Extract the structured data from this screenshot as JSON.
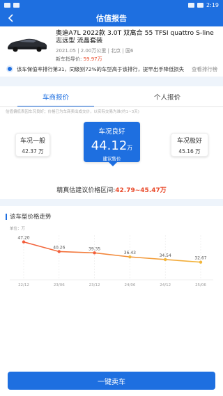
{
  "status_bar": {
    "time": "2:19"
  },
  "nav": {
    "title": "估值报告"
  },
  "car": {
    "name": "奥迪A7L 2022款 3.0T 双离合 55 TFSI quattro S-line 志远型 流晶套装",
    "meta": "2021.05 | 2.00万公里 | 北京 | 国6",
    "price_label": "新车指导价:",
    "price_value": "59.97万"
  },
  "rank": {
    "text": "该车保值率排行第31，同级别72%的车型高于该排行，提早出手降低损失",
    "link": "查看排行榜"
  },
  "tabs": [
    "车商报价",
    "个人报价"
  ],
  "note": "估值偏低表因车况良好；价格已为车商卖出成交价，以实际交易为准(约1~3天)",
  "conditions": {
    "left": {
      "label": "车况一般",
      "price": "42.37 万"
    },
    "mid": {
      "label": "车况良好",
      "price": "44.12",
      "unit": "万",
      "sub": "建议售价"
    },
    "right": {
      "label": "车况极好",
      "price": "45.16 万"
    }
  },
  "range": {
    "label": "精真估建议价格区间:",
    "value": "42.79~45.47万"
  },
  "trend": {
    "title": "该车型价格走势"
  },
  "chart_data": {
    "type": "line",
    "ylabel": "单位：万",
    "categories": [
      "22/12",
      "23/06",
      "23/12",
      "24/06",
      "24/12",
      "25/06"
    ],
    "series": [
      {
        "values": [
          47.2,
          40.26,
          39.35,
          36.43,
          34.54,
          32.67
        ]
      }
    ],
    "point_labels": [
      "47.20",
      "40.26",
      "39.35",
      "36.43",
      "34.54",
      "32.67"
    ],
    "colors": {
      "start": "#f25d3b",
      "end": "#f2b63b"
    }
  },
  "cta": {
    "label": "一键卖车"
  }
}
